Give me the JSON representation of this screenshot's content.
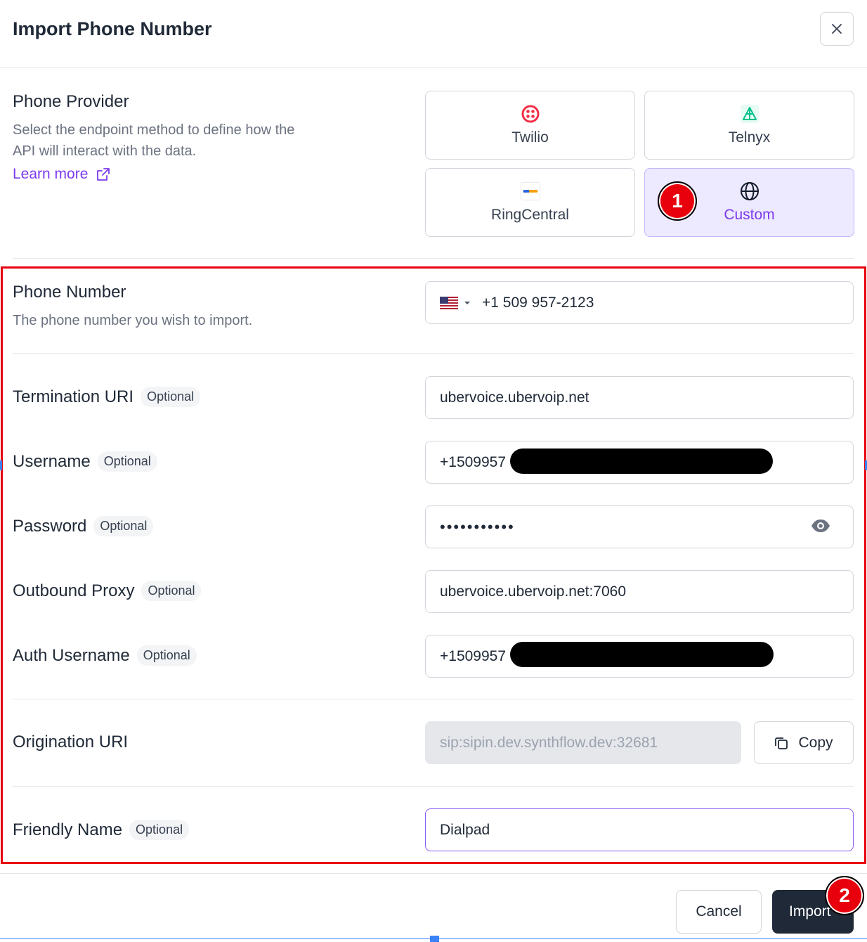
{
  "dialog": {
    "title": "Import Phone Number",
    "close_icon": "close-icon"
  },
  "provider_section": {
    "title": "Phone Provider",
    "description_line1": "Select the endpoint method to define how the",
    "description_line2": "API will interact with the data.",
    "learn_more": "Learn more",
    "providers": [
      {
        "label": "Twilio",
        "icon": "twilio-icon",
        "selected": false
      },
      {
        "label": "Telnyx",
        "icon": "telnyx-icon",
        "selected": false
      },
      {
        "label": "RingCentral",
        "icon": "ringcentral-icon",
        "selected": false
      },
      {
        "label": "Custom",
        "icon": "globe-icon",
        "selected": true
      }
    ]
  },
  "phone_section": {
    "title": "Phone Number",
    "description": "The phone number you wish to import.",
    "country_flag": "us-flag-icon",
    "value": "+1 509 957-2123"
  },
  "fields": {
    "optional_tag": "Optional",
    "termination_uri": {
      "label": "Termination URI",
      "value": "ubervoice.ubervoip.net"
    },
    "username": {
      "label": "Username",
      "value": "+1509957"
    },
    "password": {
      "label": "Password",
      "value": "•••••••••••"
    },
    "outbound_proxy": {
      "label": "Outbound Proxy",
      "value": "ubervoice.ubervoip.net:7060"
    },
    "auth_username": {
      "label": "Auth Username",
      "value": "+1509957"
    },
    "origination_uri": {
      "label": "Origination URI",
      "value": "sip:sipin.dev.synthflow.dev:32681",
      "copy_label": "Copy"
    },
    "friendly_name": {
      "label": "Friendly Name",
      "value": "Dialpad"
    }
  },
  "footer": {
    "cancel": "Cancel",
    "import": "Import"
  },
  "annotations": {
    "badge_1": "1",
    "badge_2": "2"
  },
  "colors": {
    "accent": "#7c3aed",
    "selected_bg": "#ede9fe",
    "annotation_red": "#e8000d",
    "primary_button": "#1f2937"
  }
}
